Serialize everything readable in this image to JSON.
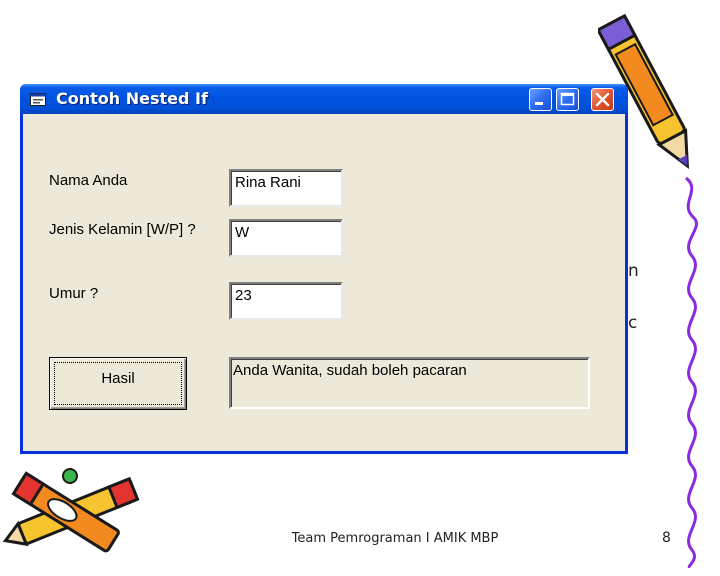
{
  "window": {
    "title": "Contoh Nested If"
  },
  "form": {
    "name_label": "Nama Anda",
    "name_value": "Rina Rani",
    "gender_label": "Jenis Kelamin [W/P] ?",
    "gender_value": "W",
    "age_label": "Umur ?",
    "age_value": "23",
    "result_button_label": "Hasil",
    "result_text": "Anda Wanita, sudah boleh pacaran"
  },
  "slide": {
    "footer": "Team Pemrograman I AMIK MBP",
    "page_number": "8",
    "side_glyph_1": "n",
    "side_glyph_2": "c"
  },
  "icons": {
    "app": "form-icon",
    "minimize": "minimize-icon",
    "maximize": "maximize-icon",
    "close": "close-icon",
    "pencil_top": "pencil-icon",
    "pencils_bottom": "pencils-icon"
  },
  "colors": {
    "title_bar": "#0053e1",
    "window_face": "#ece9d8",
    "close_button": "#e2532d"
  }
}
